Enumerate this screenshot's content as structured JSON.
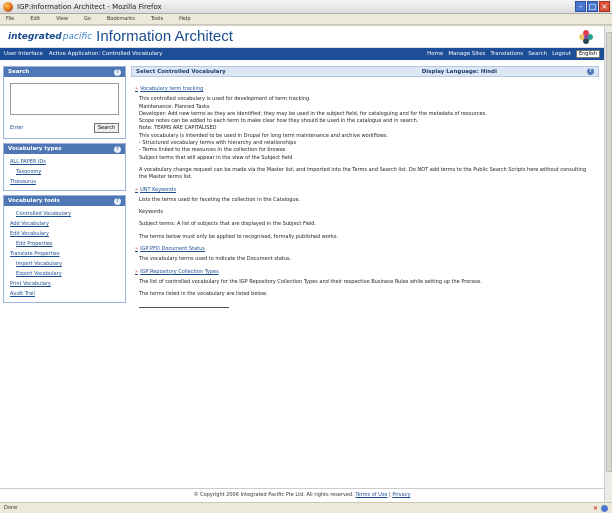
{
  "window": {
    "title": "IGP:Information Architect - Mozilla Firefox",
    "minimize": "–",
    "maximize": "□",
    "close": "×"
  },
  "menubar": {
    "items": [
      "File",
      "Edit",
      "View",
      "Go",
      "Bookmarks",
      "Tools",
      "Help"
    ]
  },
  "header": {
    "logo_prefix": "integrated",
    "logo_suffix": "pacific",
    "app_title": "Information Architect"
  },
  "topnav": {
    "left": [
      "User Interface",
      "Active Application: Controlled Vocabulary"
    ],
    "right": [
      "Home",
      "Manage Sites",
      "Translations",
      "Search",
      "Logout"
    ],
    "language": "English"
  },
  "sidebar": {
    "search_title": "Search",
    "enter_label": "Enter",
    "search_button": "Search",
    "vocab_types_title": "Vocabulary types",
    "vocab_types_items": [
      "ALL PAPER IDs",
      "Taxonomy",
      "Thesaurus"
    ],
    "vocab_tools_title": "Vocabulary tools",
    "vocab_tools_items": [
      {
        "label": "Controlled Vocabulary",
        "sub": true
      },
      {
        "label": "Add Vocabulary",
        "sub": false
      },
      {
        "label": "Edit Vocabulary",
        "sub": false
      },
      {
        "label": "Edit Properties",
        "sub": true
      },
      {
        "label": "Translate Properties",
        "sub": false
      },
      {
        "label": "Import Vocabulary",
        "sub": true
      },
      {
        "label": "Export Vocabulary",
        "sub": true
      },
      {
        "label": "Print Vocabulary",
        "sub": false
      },
      {
        "label": "Audit Trail",
        "sub": false
      }
    ]
  },
  "main": {
    "title": "Select Controlled Vocabulary",
    "display_language": "Display Language: Hindi",
    "sections": [
      {
        "heading": "Vocabulary term tracking",
        "lines": [
          "This controlled vocabulary is used for development of term tracking.",
          "Maintenance: Planned Tasks",
          "Developer: Add new terms as they are identified; they may be used in the subject field, for cataloguing and for the metadata of resources.",
          "Scope notes can be added to each term to make clear how they should be used in the catalogue and in search.",
          "Note: TERMS ARE CAPITALISED",
          "This vocabulary is intended to be used in Drupal for long term maintenance and archive workflows.",
          "  - Structured vocabulary terms with hierarchy and relationships",
          "  - Terms linked to the resources in the collection for browse",
          "  Subject terms that will appear in the view of the Subject field",
          "A vocabulary change request can be made via the Master list, and imported into the Terms and Search list. Do NOT add terms to the Public Search Scripts here without consulting the Master terms list."
        ]
      },
      {
        "heading": "UNT Keywords",
        "lines": [
          "Lists the terms used for faceting the collection in the Catalogue.",
          "Keywords",
          "Subject terms: A list of subjects that are displayed in the Subject Field.",
          "The terms below must only be applied to recognised, formally published works."
        ]
      },
      {
        "heading": "IGP:PFD Document Status",
        "lines": [
          "The vocabulary terms used to indicate the Document status."
        ]
      },
      {
        "heading": "IGP:Repository Collection Types",
        "lines": [
          "The list of controlled vocabulary for the IGP Repository Collection Types and their respective Business Rules while setting up the Process.",
          "The terms listed in the vocabulary are listed below."
        ]
      }
    ]
  },
  "footer": {
    "copyright": "© Copyright 2006 Integrated Pacific Pte Ltd. All rights reserved.",
    "terms_link": "Terms of Use",
    "privacy_link": "Privacy"
  },
  "statusbar": {
    "text": "Done"
  }
}
